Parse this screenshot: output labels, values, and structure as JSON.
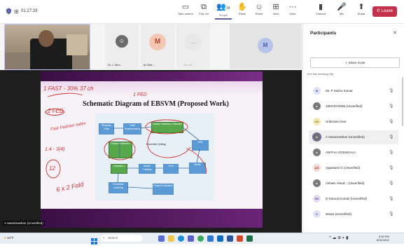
{
  "toolbar": {
    "timer": "01:27:33",
    "buttons": [
      {
        "name": "take-control",
        "label": "Take control",
        "icon": "▭"
      },
      {
        "name": "pop-out",
        "label": "Pop out",
        "icon": "⧉"
      },
      {
        "name": "people",
        "label": "People",
        "icon": "👥",
        "count": "34"
      },
      {
        "name": "raise",
        "label": "Raise",
        "icon": "✋"
      },
      {
        "name": "react",
        "label": "React",
        "icon": "☺"
      },
      {
        "name": "view",
        "label": "View",
        "icon": "⊞"
      },
      {
        "name": "more",
        "label": "More",
        "icon": "⋯"
      },
      {
        "name": "camera",
        "label": "Camera",
        "icon": "▮"
      },
      {
        "name": "mic",
        "label": "Mic",
        "icon": "🎤"
      },
      {
        "name": "share",
        "label": "Share",
        "icon": "⬆"
      }
    ],
    "leave_label": "Leave",
    "leave_color": "#c4314b",
    "accent_color": "#6264a7"
  },
  "tiles": [
    {
      "name": "Dr. L Srini...",
      "initials": "",
      "avatar_color": "#6b6b6b"
    },
    {
      "name": "M.Gitik...",
      "initials": "M",
      "avatar_color": "#f4c7b5",
      "text_color": "#b14728"
    },
    {
      "name": "You all",
      "initials": "...",
      "avatar_color": "#e8e8e8",
      "text_color": "#bbbbbb"
    },
    {
      "name": "",
      "initials": "M",
      "avatar_color": "#b6c4ea",
      "text_color": "#4a5ca8"
    }
  ],
  "slide": {
    "title": "Schematic Diagram of EBSVM (Proposed Work)",
    "boxes": {
      "b1": "Request Data",
      "b2": "Data Preprocessing",
      "b3": "Feature Selection Classifier",
      "b4": "Feature Selection",
      "b5": "EVA",
      "b6": "Ensemble (Voting)",
      "b7": "Classifier 1",
      "b8": "Model Training",
      "b9": "SVM",
      "b10": "Model",
      "b11": "Ensemble Learning",
      "b12": "Output Evaluation"
    },
    "annotations": {
      "a1": "1 FAST - 30% 37 ch",
      "a2": "2 FED",
      "a3": "FSt...",
      "a4": "Fast Fashion Index",
      "a5": "1 FED",
      "a6": "1.4 - 3(4)",
      "a7": "12",
      "a8": "6 x 2 Fold"
    },
    "presenter": "A Swaminathan (Unverified)"
  },
  "panel": {
    "title": "Participants",
    "share_invite": "Share invite",
    "group_label": "▾ In this meeting (34)",
    "participants": [
      {
        "initials": "M",
        "name": "Mr. P Sasho Kumar",
        "avatar_color": "#dfe3f7",
        "text_color": "#4a5ca8"
      },
      {
        "initials": "",
        "name": "19MYDA0036 (Unverified)",
        "avatar_color": "#7a7a7a",
        "text_color": "#ffffff"
      },
      {
        "initials": "UU",
        "name": "Unknown User",
        "avatar_color": "#f3e8b8",
        "text_color": "#8a6d1a"
      },
      {
        "initials": "A",
        "name": "A Swaminathan (Unverified)",
        "avatar_color": "#6f6f6f",
        "text_color": "#ffffff"
      },
      {
        "initials": "",
        "name": "ANITHA GODUGALA",
        "avatar_color": "#7a7a7a",
        "text_color": "#ffffff"
      },
      {
        "initials": "AG",
        "name": "Appasami G (Unverified)",
        "avatar_color": "#f1d8d2",
        "text_color": "#9a3d22"
      },
      {
        "initials": "",
        "name": "Ashwin Vinod... (Unverified)",
        "avatar_color": "#7a7a7a",
        "text_color": "#ffffff"
      },
      {
        "initials": "DK",
        "name": "D Karuna Kumari (Unverified)",
        "avatar_color": "#e3dcf3",
        "text_color": "#5a3f9a"
      },
      {
        "initials": "D",
        "name": "deepa (Unverified)",
        "avatar_color": "#dfe3f7",
        "text_color": "#4a5ca8"
      }
    ]
  },
  "taskbar": {
    "weather": "33°F",
    "search_placeholder": "Search",
    "time": "3:30 PM",
    "date": "8/31/2022",
    "apps": [
      {
        "name": "widgets",
        "color": "#5b6fd1"
      },
      {
        "name": "file-explorer",
        "color": "#f3c54a"
      },
      {
        "name": "edge",
        "color": "#1f8ed6"
      },
      {
        "name": "teams",
        "color": "#5b5fc7"
      },
      {
        "name": "chrome",
        "color": "#3aa75a"
      },
      {
        "name": "store",
        "color": "#2f78d4"
      },
      {
        "name": "mail",
        "color": "#0f6cbd"
      },
      {
        "name": "word",
        "color": "#2b579a"
      },
      {
        "name": "powerpoint",
        "color": "#d24726"
      },
      {
        "name": "excel",
        "color": "#1d7044"
      }
    ]
  }
}
